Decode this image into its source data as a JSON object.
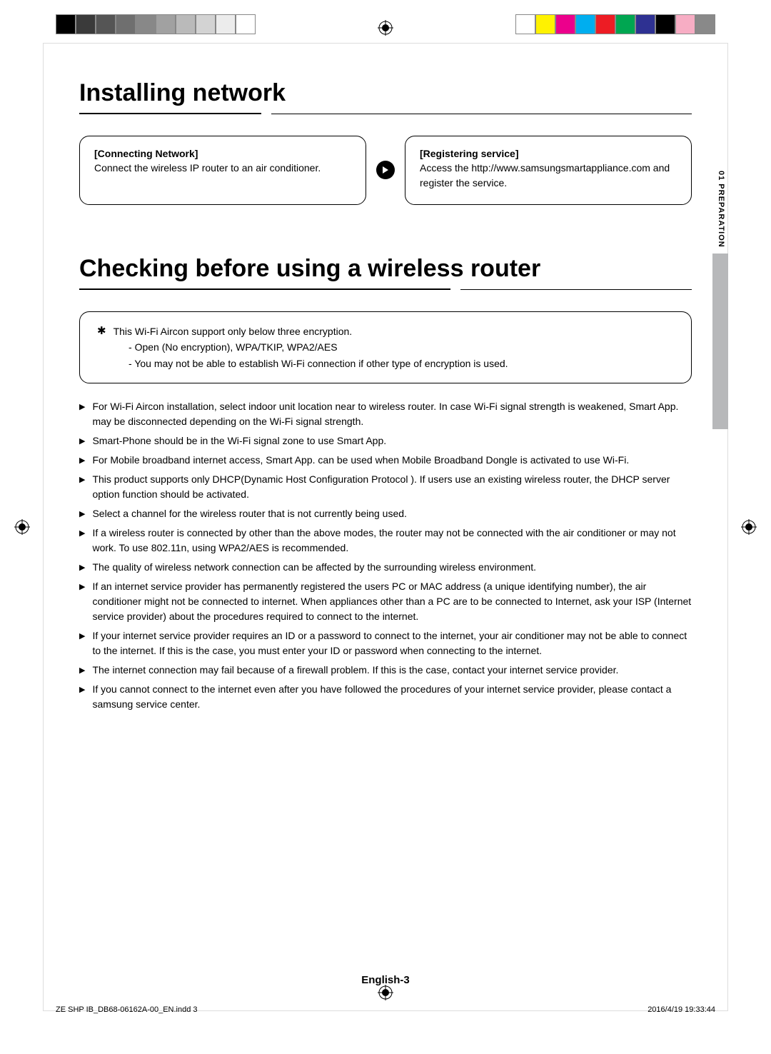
{
  "colorbar_left": [
    "#000000",
    "#3a3a3a",
    "#555555",
    "#6f6f6f",
    "#888888",
    "#a1a1a1",
    "#bababa",
    "#d3d3d3",
    "#ececec",
    "#ffffff"
  ],
  "colorbar_right": [
    "#ffffff",
    "#fff200",
    "#ec008c",
    "#00aeef",
    "#ed1c24",
    "#00a651",
    "#2e3192",
    "#000000",
    "#f7adc4",
    "#898989"
  ],
  "side_label": "01  PREPARATION",
  "h1a": "Installing network",
  "steps": {
    "left_title": "[Connecting Network]",
    "left_body": "Connect the wireless IP router to an air conditioner.",
    "right_title": "[Registering service]",
    "right_body": "Access the  http://www.samsungsmartappliance.com and register the service."
  },
  "h1b": "Checking before using a wireless router",
  "note": {
    "main": "This Wi-Fi Aircon support only below three encryption.",
    "sub1": "Open (No encryption), WPA/TKIP, WPA2/AES",
    "sub2": "You may not be able to establish Wi-Fi connection if other type of encryption is used."
  },
  "bullets": [
    "For Wi-Fi Aircon installation, select indoor unit location near to wireless router. In case Wi-Fi signal strength is weakened, Smart App. may be disconnected depending on the Wi-Fi signal strength.",
    "Smart-Phone should be in the Wi-Fi signal zone to use Smart App.",
    "For Mobile broadband internet access, Smart App. can be used when Mobile Broadband Dongle is activated to use Wi-Fi.",
    "This product supports only DHCP(Dynamic Host Configuration Protocol ). If users use an existing wireless router, the DHCP server option function should be activated.",
    "Select a channel for the wireless router that is not currently being used.",
    "If a wireless router is connected by other than the above modes, the router may not be connected with the air conditioner or may not work. To use 802.11n, using WPA2/AES is recommended.",
    "The quality of wireless network connection can be affected by the surrounding wireless environment.",
    "If an internet service provider has permanently registered the users PC or MAC address (a unique identifying number), the air conditioner might not be connected to internet. When appliances other than a PC are to be connected to Internet, ask your ISP (Internet service provider) about the procedures required to connect to the internet.",
    "If your internet service provider requires an ID or a password to connect to the internet, your air conditioner may not be able to connect to the internet. If this is the case, you must enter your ID or password when connecting to the internet.",
    "The internet connection may fail because of a firewall problem. If this is the case, contact your internet service provider.",
    "If you cannot connect to the internet even after you have followed the procedures of your internet service provider, please contact a samsung service center."
  ],
  "page_num": "English-3",
  "footer_left": "ZE SHP IB_DB68-06162A-00_EN.indd   3",
  "footer_right": "2016/4/19   19:33:44"
}
